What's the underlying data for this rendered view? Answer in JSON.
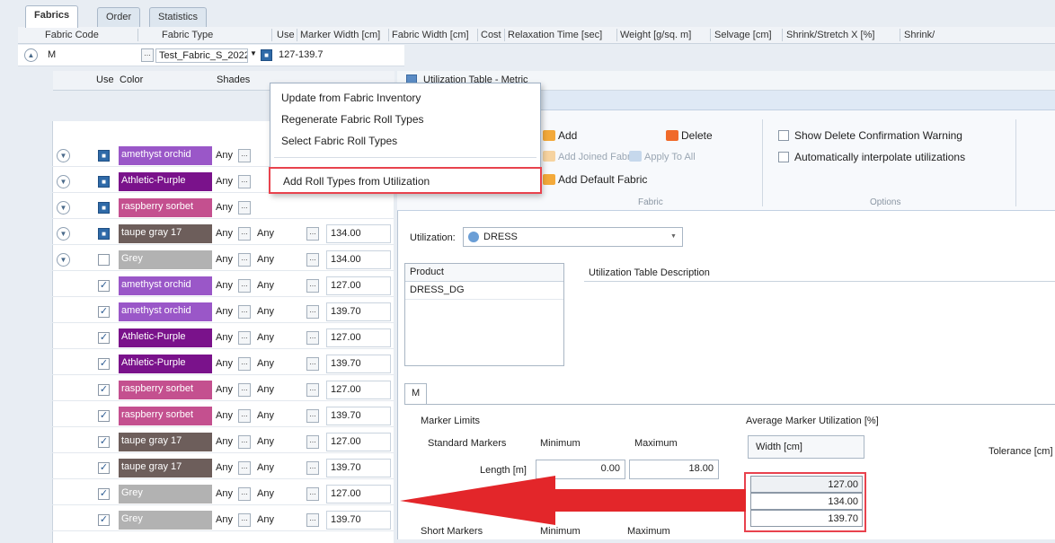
{
  "tabs": [
    "Fabrics",
    "Order",
    "Statistics"
  ],
  "header": {
    "fabric_code": "Fabric Code",
    "fabric_type": "Fabric Type",
    "use": "Use",
    "marker_width": "Marker Width [cm]",
    "fabric_width": "Fabric Width [cm]",
    "cost": "Cost",
    "relaxation_time": "Relaxation Time [sec]",
    "weight": "Weight [g/sq. m]",
    "selvage": "Selvage [cm]",
    "shrink_x": "Shrink/Stretch X [%]",
    "shrink_y": "Shrink/"
  },
  "main_row": {
    "fabric_code": "M",
    "fabric_type": "Test_Fabric_S_2022",
    "marker_width": "127-139.7"
  },
  "sub_header": {
    "use": "Use",
    "color": "Color",
    "shades": "Shades"
  },
  "colors": {
    "amethyst": "#9a57c8",
    "athletic": "#7a128b",
    "raspberry": "#c4508f",
    "taupe": "#6d5e5b",
    "grey": "#b2b2b2",
    "arrow": "#e3262a",
    "highlight": "#e8424d"
  },
  "rows": [
    {
      "type": "expand",
      "checked": "filled",
      "color": "amethyst orchid",
      "key": "amethyst",
      "shade1": "Any",
      "shade2": "",
      "width": ""
    },
    {
      "type": "expand",
      "checked": "filled",
      "color": "Athletic-Purple",
      "key": "athletic",
      "shade1": "Any",
      "shade2": "",
      "width": ""
    },
    {
      "type": "expand",
      "checked": "filled",
      "color": "raspberry sorbet",
      "key": "raspberry",
      "shade1": "Any",
      "shade2": "",
      "width": ""
    },
    {
      "type": "expand",
      "checked": "filled",
      "color": "taupe gray 17",
      "key": "taupe",
      "shade1": "Any",
      "shade2": "Any",
      "width": "134.00"
    },
    {
      "type": "expand",
      "checked": "empty",
      "color": "Grey",
      "key": "grey",
      "shade1": "Any",
      "shade2": "Any",
      "width": "134.00"
    },
    {
      "type": "child",
      "checked": "check",
      "color": "amethyst orchid",
      "key": "amethyst",
      "shade1": "Any",
      "shade2": "Any",
      "width": "127.00"
    },
    {
      "type": "child",
      "checked": "check",
      "color": "amethyst orchid",
      "key": "amethyst",
      "shade1": "Any",
      "shade2": "Any",
      "width": "139.70"
    },
    {
      "type": "child",
      "checked": "check",
      "color": "Athletic-Purple",
      "key": "athletic",
      "shade1": "Any",
      "shade2": "Any",
      "width": "127.00"
    },
    {
      "type": "child",
      "checked": "check",
      "color": "Athletic-Purple",
      "key": "athletic",
      "shade1": "Any",
      "shade2": "Any",
      "width": "139.70"
    },
    {
      "type": "child",
      "checked": "check",
      "color": "raspberry sorbet",
      "key": "raspberry",
      "shade1": "Any",
      "shade2": "Any",
      "width": "127.00"
    },
    {
      "type": "child",
      "checked": "check",
      "color": "raspberry sorbet",
      "key": "raspberry",
      "shade1": "Any",
      "shade2": "Any",
      "width": "139.70"
    },
    {
      "type": "child",
      "checked": "check",
      "color": "taupe gray 17",
      "key": "taupe",
      "shade1": "Any",
      "shade2": "Any",
      "width": "127.00"
    },
    {
      "type": "child",
      "checked": "check",
      "color": "taupe gray 17",
      "key": "taupe",
      "shade1": "Any",
      "shade2": "Any",
      "width": "139.70"
    },
    {
      "type": "child",
      "checked": "check",
      "color": "Grey",
      "key": "grey",
      "shade1": "Any",
      "shade2": "Any",
      "width": "127.00"
    },
    {
      "type": "child",
      "checked": "check",
      "color": "Grey",
      "key": "grey",
      "shade1": "Any",
      "shade2": "Any",
      "width": "139.70"
    }
  ],
  "context_menu": {
    "items": [
      "Update from Fabric Inventory",
      "Regenerate Fabric Roll Types",
      "Select Fabric Roll Types",
      "Add Roll Types from Utilization"
    ]
  },
  "utilization_window": {
    "title": "Utilization Table - Metric",
    "ribbon": {
      "add": "Add",
      "delete": "Delete",
      "add_joined": "Add Joined Fabric",
      "apply_all": "Apply To All",
      "add_default": "Add Default Fabric",
      "group_fabric": "Fabric",
      "show_delete": "Show Delete Confirmation Warning",
      "auto_interp": "Automatically interpolate utilizations",
      "group_options": "Options"
    },
    "utilization_label": "Utilization:",
    "utilization_value": "DRESS",
    "product_header": "Product",
    "product_value": "DRESS_DG",
    "desc_header": "Utilization Table Description",
    "tab_m": "M",
    "marker_limits": "Marker Limits",
    "standard_markers": "Standard Markers",
    "minimum": "Minimum",
    "maximum": "Maximum",
    "length": "Length [m]",
    "length_min": "0.00",
    "length_max": "18.00",
    "short_markers": "Short Markers",
    "short_min": "Minimum",
    "short_max": "Maximum",
    "avg_util": "Average Marker Utilization [%]",
    "width_header": "Width [cm]",
    "tolerance": "Tolerance [cm]",
    "widths": [
      "127.00",
      "134.00",
      "139.70"
    ]
  }
}
